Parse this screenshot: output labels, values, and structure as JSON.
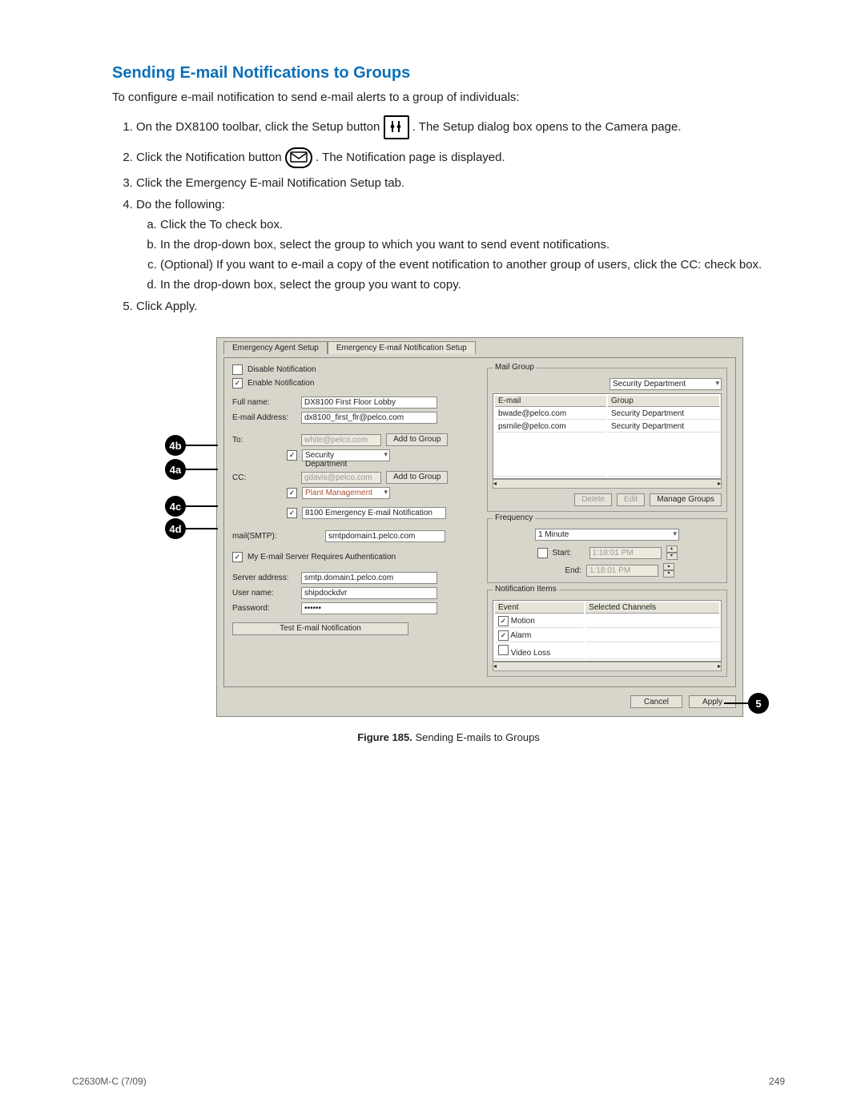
{
  "heading": "Sending E-mail Notifications to Groups",
  "intro": "To configure e-mail notification to send e-mail alerts to a group of individuals:",
  "steps": {
    "s1a": "On the DX8100 toolbar, click the Setup button ",
    "s1b": ". The Setup dialog box opens to the Camera page.",
    "s2a": "Click the Notification button ",
    "s2b": ". The Notification page is displayed.",
    "s3": "Click the Emergency E-mail Notification Setup tab.",
    "s4": "Do the following:",
    "s4a": "Click the To check box.",
    "s4b": "In the drop-down box, select the group to which you want to send event notifications.",
    "s4c": "(Optional) If you want to e-mail a copy of the event notification to another group of users, click the CC: check box.",
    "s4d": "In the drop-down box, select the group you want to copy.",
    "s5": "Click Apply."
  },
  "callouts": {
    "c4b": "4b",
    "c4a": "4a",
    "c4c": "4c",
    "c4d": "4d",
    "c5": "5"
  },
  "dialog": {
    "tab1": "Emergency Agent Setup",
    "tab2": "Emergency E-mail Notification Setup",
    "radio_disable": "Disable Notification",
    "radio_enable": "Enable Notification",
    "full_name_label": "Full name:",
    "full_name": "DX8100 First Floor Lobby",
    "email_label": "E-mail Address:",
    "email": "dx8100_first_flr@pelco.com",
    "to_label": "To:",
    "to_email": "white@pelco.com",
    "add_to_group": "Add to Group",
    "to_group": "Security Department",
    "cc_label": "CC:",
    "cc_email": "gdavis@pelco.com",
    "cc_group": "Plant Management",
    "subject": "8100 Emergency E-mail Notification",
    "smtp_label": "mail(SMTP):",
    "smtp": "smtpdomain1.pelco.com",
    "auth_label": "My E-mail Server Requires Authentication",
    "server_label": "Server address:",
    "server": "smtp.domain1.pelco.com",
    "user_label": "User name:",
    "user": "shipdockdvr",
    "pass_label": "Password:",
    "pass": "••••••",
    "test_btn": "Test E-mail Notification",
    "mail_group_legend": "Mail Group",
    "mg_select": "Security Department",
    "mg_col1": "E-mail",
    "mg_col2": "Group",
    "mg_rows": [
      {
        "email": "bwade@pelco.com",
        "group": "Security Department"
      },
      {
        "email": "psmile@pelco.com",
        "group": "Security Department"
      }
    ],
    "btn_delete": "Delete",
    "btn_edit": "Edit",
    "btn_manage": "Manage Groups",
    "freq_legend": "Frequency",
    "freq_interval": "1 Minute",
    "freq_start_label": "Start:",
    "freq_start": "1:18:01 PM",
    "freq_end_label": "End:",
    "freq_end": "1:18:01 PM",
    "ni_legend": "Notification Items",
    "ni_col1": "Event",
    "ni_col2": "Selected Channels",
    "ni_motion": "Motion",
    "ni_alarm": "Alarm",
    "ni_video": "Video Loss",
    "btn_cancel": "Cancel",
    "btn_apply": "Apply"
  },
  "figure": {
    "label": "Figure 185.",
    "text": " Sending E-mails to Groups"
  },
  "footer": {
    "left": "C2630M-C (7/09)",
    "right": "249"
  }
}
